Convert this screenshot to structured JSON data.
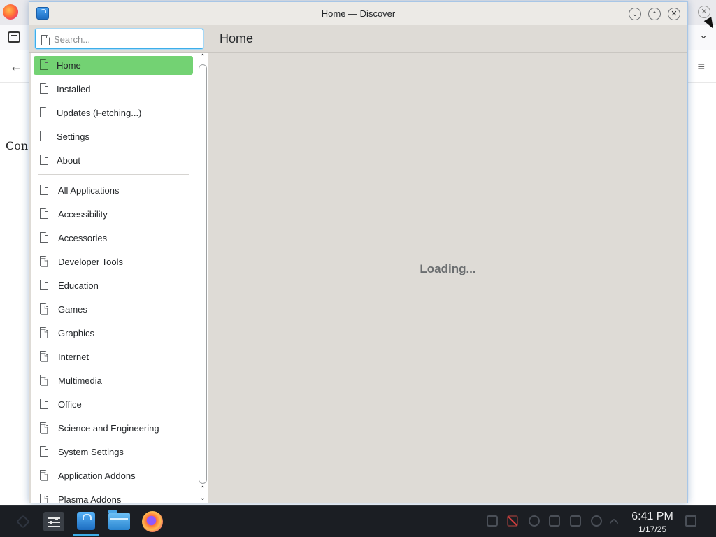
{
  "background": {
    "partial_text": "Con"
  },
  "window": {
    "title": "Home — Discover",
    "minimize_label": "⌄",
    "maximize_label": "⌃",
    "close_label": "✕"
  },
  "search": {
    "placeholder": "Search..."
  },
  "page": {
    "title": "Home",
    "loading_text": "Loading..."
  },
  "sidebar": {
    "primary": [
      {
        "label": "Home",
        "active": true
      },
      {
        "label": "Installed"
      },
      {
        "label": "Updates (Fetching...)"
      },
      {
        "label": "Settings"
      },
      {
        "label": "About"
      }
    ],
    "categories": [
      {
        "label": "All Applications"
      },
      {
        "label": "Accessibility"
      },
      {
        "label": "Accessories"
      },
      {
        "label": "Developer Tools",
        "has_sub": true
      },
      {
        "label": "Education"
      },
      {
        "label": "Games",
        "has_sub": true
      },
      {
        "label": "Graphics",
        "has_sub": true
      },
      {
        "label": "Internet",
        "has_sub": true
      },
      {
        "label": "Multimedia",
        "has_sub": true
      },
      {
        "label": "Office"
      },
      {
        "label": "Science and Engineering",
        "has_sub": true
      },
      {
        "label": "System Settings"
      },
      {
        "label": "Application Addons",
        "has_sub": true
      },
      {
        "label": "Plasma Addons",
        "has_sub": true
      }
    ]
  },
  "taskbar": {
    "time": "6:41 PM",
    "date": "1/17/25"
  },
  "colors": {
    "active_item": "#73d273",
    "accent": "#3daee9",
    "window_bg": "#dedbd6",
    "taskbar_bg": "#1b1e23"
  },
  "icons": {
    "app": "discover-icon",
    "item": "document-icon",
    "taskbar": [
      "system-settings-icon",
      "discover-icon",
      "file-manager-icon",
      "firefox-icon"
    ]
  }
}
